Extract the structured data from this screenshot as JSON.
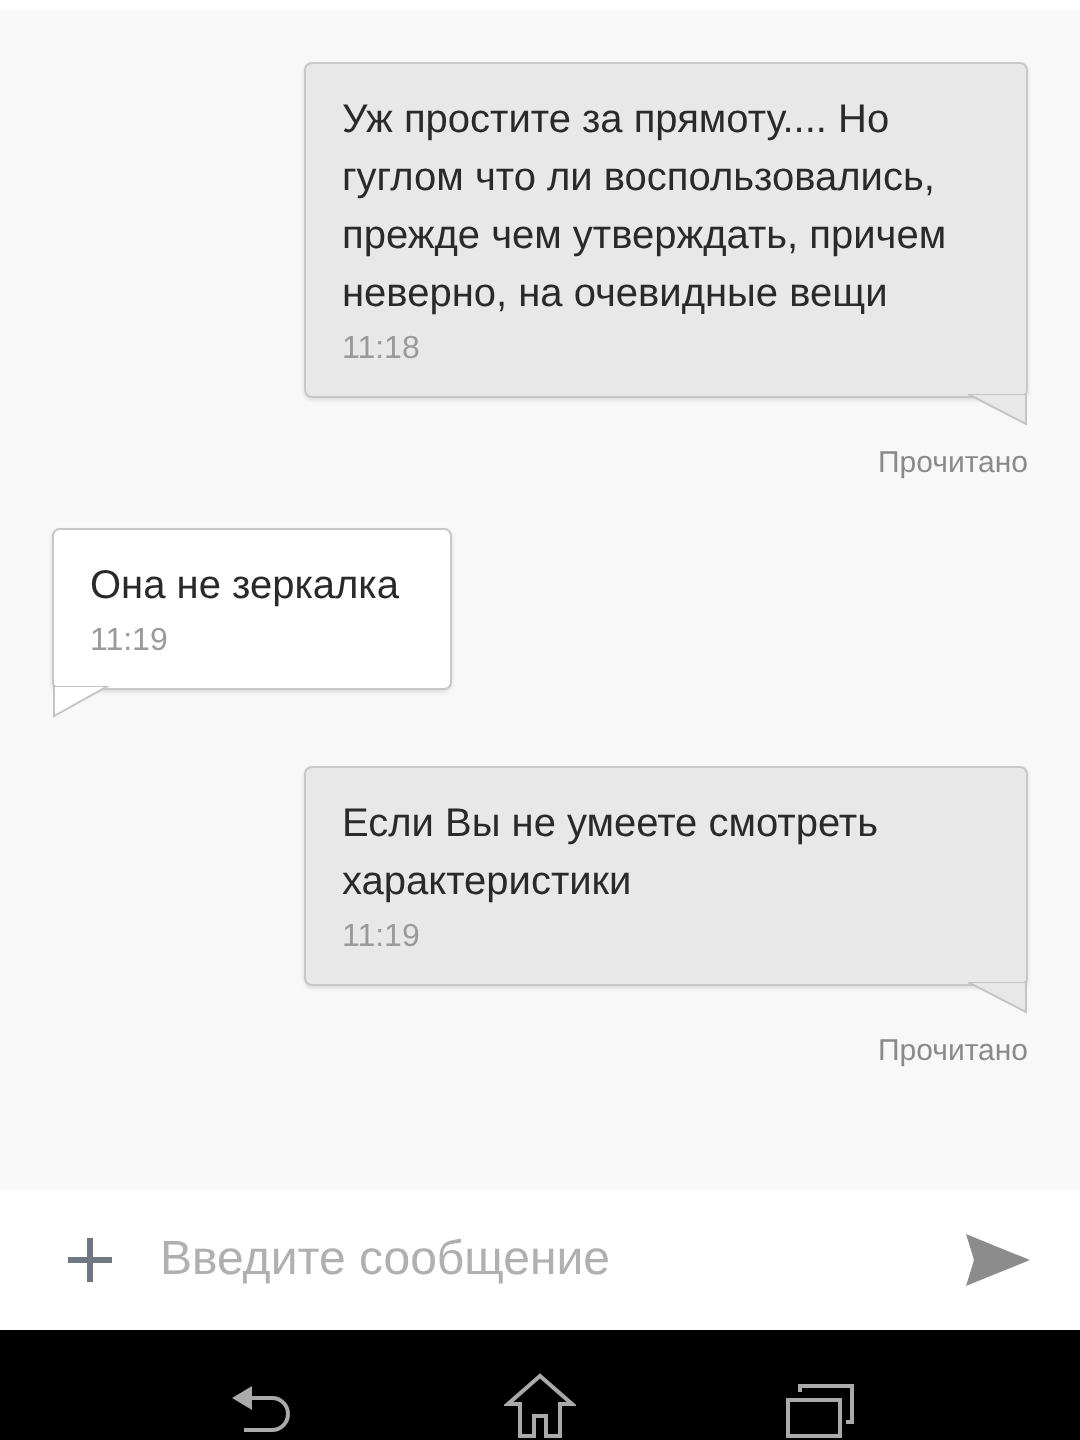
{
  "messages": [
    {
      "kind": "outgoing",
      "text": "Уж простите за прямоту.... Но гуглом что ли воспользовались, прежде чем утверждать, причем неверно, на очевидные вещи",
      "time": "11:18",
      "status": "Прочитано"
    },
    {
      "kind": "incoming",
      "text": "Она не зеркалка",
      "time": "11:19"
    },
    {
      "kind": "outgoing",
      "text": "Если Вы не умеете смотреть характеристики",
      "time": "11:19",
      "status": "Прочитано"
    }
  ],
  "composer": {
    "placeholder": "Введите сообщение"
  }
}
